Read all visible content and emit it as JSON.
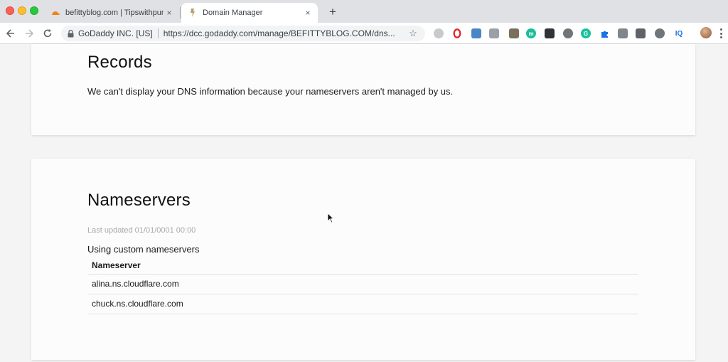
{
  "browser": {
    "tabs": [
      {
        "title": "befittyblog.com | Tipswithpunc",
        "favicon": "cloudflare-icon",
        "close": "×"
      },
      {
        "title": "Domain Manager",
        "favicon": "godaddy-icon",
        "close": "×"
      }
    ],
    "new_tab": "+",
    "address": {
      "company": "GoDaddy INC. [US]",
      "url": "https://dcc.godaddy.com/manage/BEFITTYBLOG.COM/dns..."
    },
    "extensions_text": {
      "iq": "IQ"
    }
  },
  "records": {
    "title": "Records",
    "message": "We can't display your DNS information because your nameservers aren't managed by us."
  },
  "nameservers": {
    "title": "Nameservers",
    "last_updated": "Last updated 01/01/0001 00:00",
    "mode": "Using custom nameservers",
    "column_header": "Nameserver",
    "rows": [
      "alina.ns.cloudflare.com",
      "chuck.ns.cloudflare.com"
    ]
  }
}
